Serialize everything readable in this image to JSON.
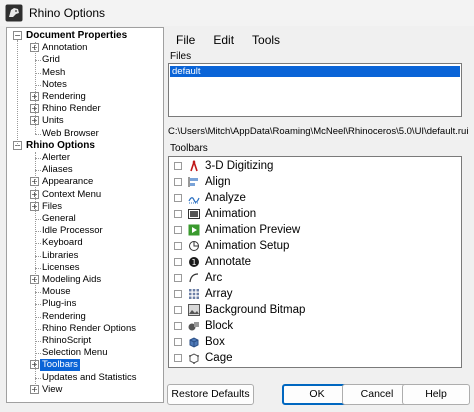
{
  "window": {
    "title": "Rhino Options"
  },
  "tree": [
    {
      "label": "Document Properties",
      "level": 0,
      "bold": true,
      "expander": "−"
    },
    {
      "label": "Annotation",
      "level": 1,
      "expander": "+"
    },
    {
      "label": "Grid",
      "level": 1
    },
    {
      "label": "Mesh",
      "level": 1
    },
    {
      "label": "Notes",
      "level": 1
    },
    {
      "label": "Rendering",
      "level": 1,
      "expander": "+"
    },
    {
      "label": "Rhino Render",
      "level": 1,
      "expander": "+"
    },
    {
      "label": "Units",
      "level": 1,
      "expander": "+"
    },
    {
      "label": "Web Browser",
      "level": 1
    },
    {
      "label": "Rhino Options",
      "level": 0,
      "bold": true,
      "expander": "−"
    },
    {
      "label": "Alerter",
      "level": 1
    },
    {
      "label": "Aliases",
      "level": 1
    },
    {
      "label": "Appearance",
      "level": 1,
      "expander": "+"
    },
    {
      "label": "Context Menu",
      "level": 1,
      "expander": "+"
    },
    {
      "label": "Files",
      "level": 1,
      "expander": "+"
    },
    {
      "label": "General",
      "level": 1
    },
    {
      "label": "Idle Processor",
      "level": 1
    },
    {
      "label": "Keyboard",
      "level": 1
    },
    {
      "label": "Libraries",
      "level": 1
    },
    {
      "label": "Licenses",
      "level": 1
    },
    {
      "label": "Modeling Aids",
      "level": 1,
      "expander": "+"
    },
    {
      "label": "Mouse",
      "level": 1
    },
    {
      "label": "Plug-ins",
      "level": 1
    },
    {
      "label": "Rendering",
      "level": 1
    },
    {
      "label": "Rhino Render Options",
      "level": 1
    },
    {
      "label": "RhinoScript",
      "level": 1
    },
    {
      "label": "Selection Menu",
      "level": 1
    },
    {
      "label": "Toolbars",
      "level": 1,
      "expander": "+",
      "selected": true
    },
    {
      "label": "Updates and Statistics",
      "level": 1
    },
    {
      "label": "View",
      "level": 1,
      "expander": "+"
    }
  ],
  "menu": {
    "file": "File",
    "edit": "Edit",
    "tools": "Tools"
  },
  "files": {
    "label": "Files",
    "selected_item": "default"
  },
  "path": "C:\\Users\\Mitch\\AppData\\Roaming\\McNeel\\Rhinoceros\\5.0\\UI\\default.rui",
  "toolbars": {
    "label": "Toolbars",
    "items": [
      {
        "label": "3-D Digitizing",
        "icon": "digitizer-icon"
      },
      {
        "label": "Align",
        "icon": "align-icon"
      },
      {
        "label": "Analyze",
        "icon": "analyze-icon"
      },
      {
        "label": "Animation",
        "icon": "animation-icon"
      },
      {
        "label": "Animation Preview",
        "icon": "play-icon"
      },
      {
        "label": "Animation Setup",
        "icon": "animation-setup-icon"
      },
      {
        "label": "Annotate",
        "icon": "annotate-icon"
      },
      {
        "label": "Arc",
        "icon": "arc-icon"
      },
      {
        "label": "Array",
        "icon": "array-icon"
      },
      {
        "label": "Background Bitmap",
        "icon": "background-bitmap-icon"
      },
      {
        "label": "Block",
        "icon": "block-icon"
      },
      {
        "label": "Box",
        "icon": "box-icon"
      },
      {
        "label": "Cage",
        "icon": "cage-icon"
      }
    ]
  },
  "buttons": {
    "restore_defaults": "Restore Defaults",
    "ok": "OK",
    "cancel": "Cancel",
    "help": "Help"
  },
  "colors": {
    "selection": "#0a64d7",
    "accent": "#0067c0"
  }
}
